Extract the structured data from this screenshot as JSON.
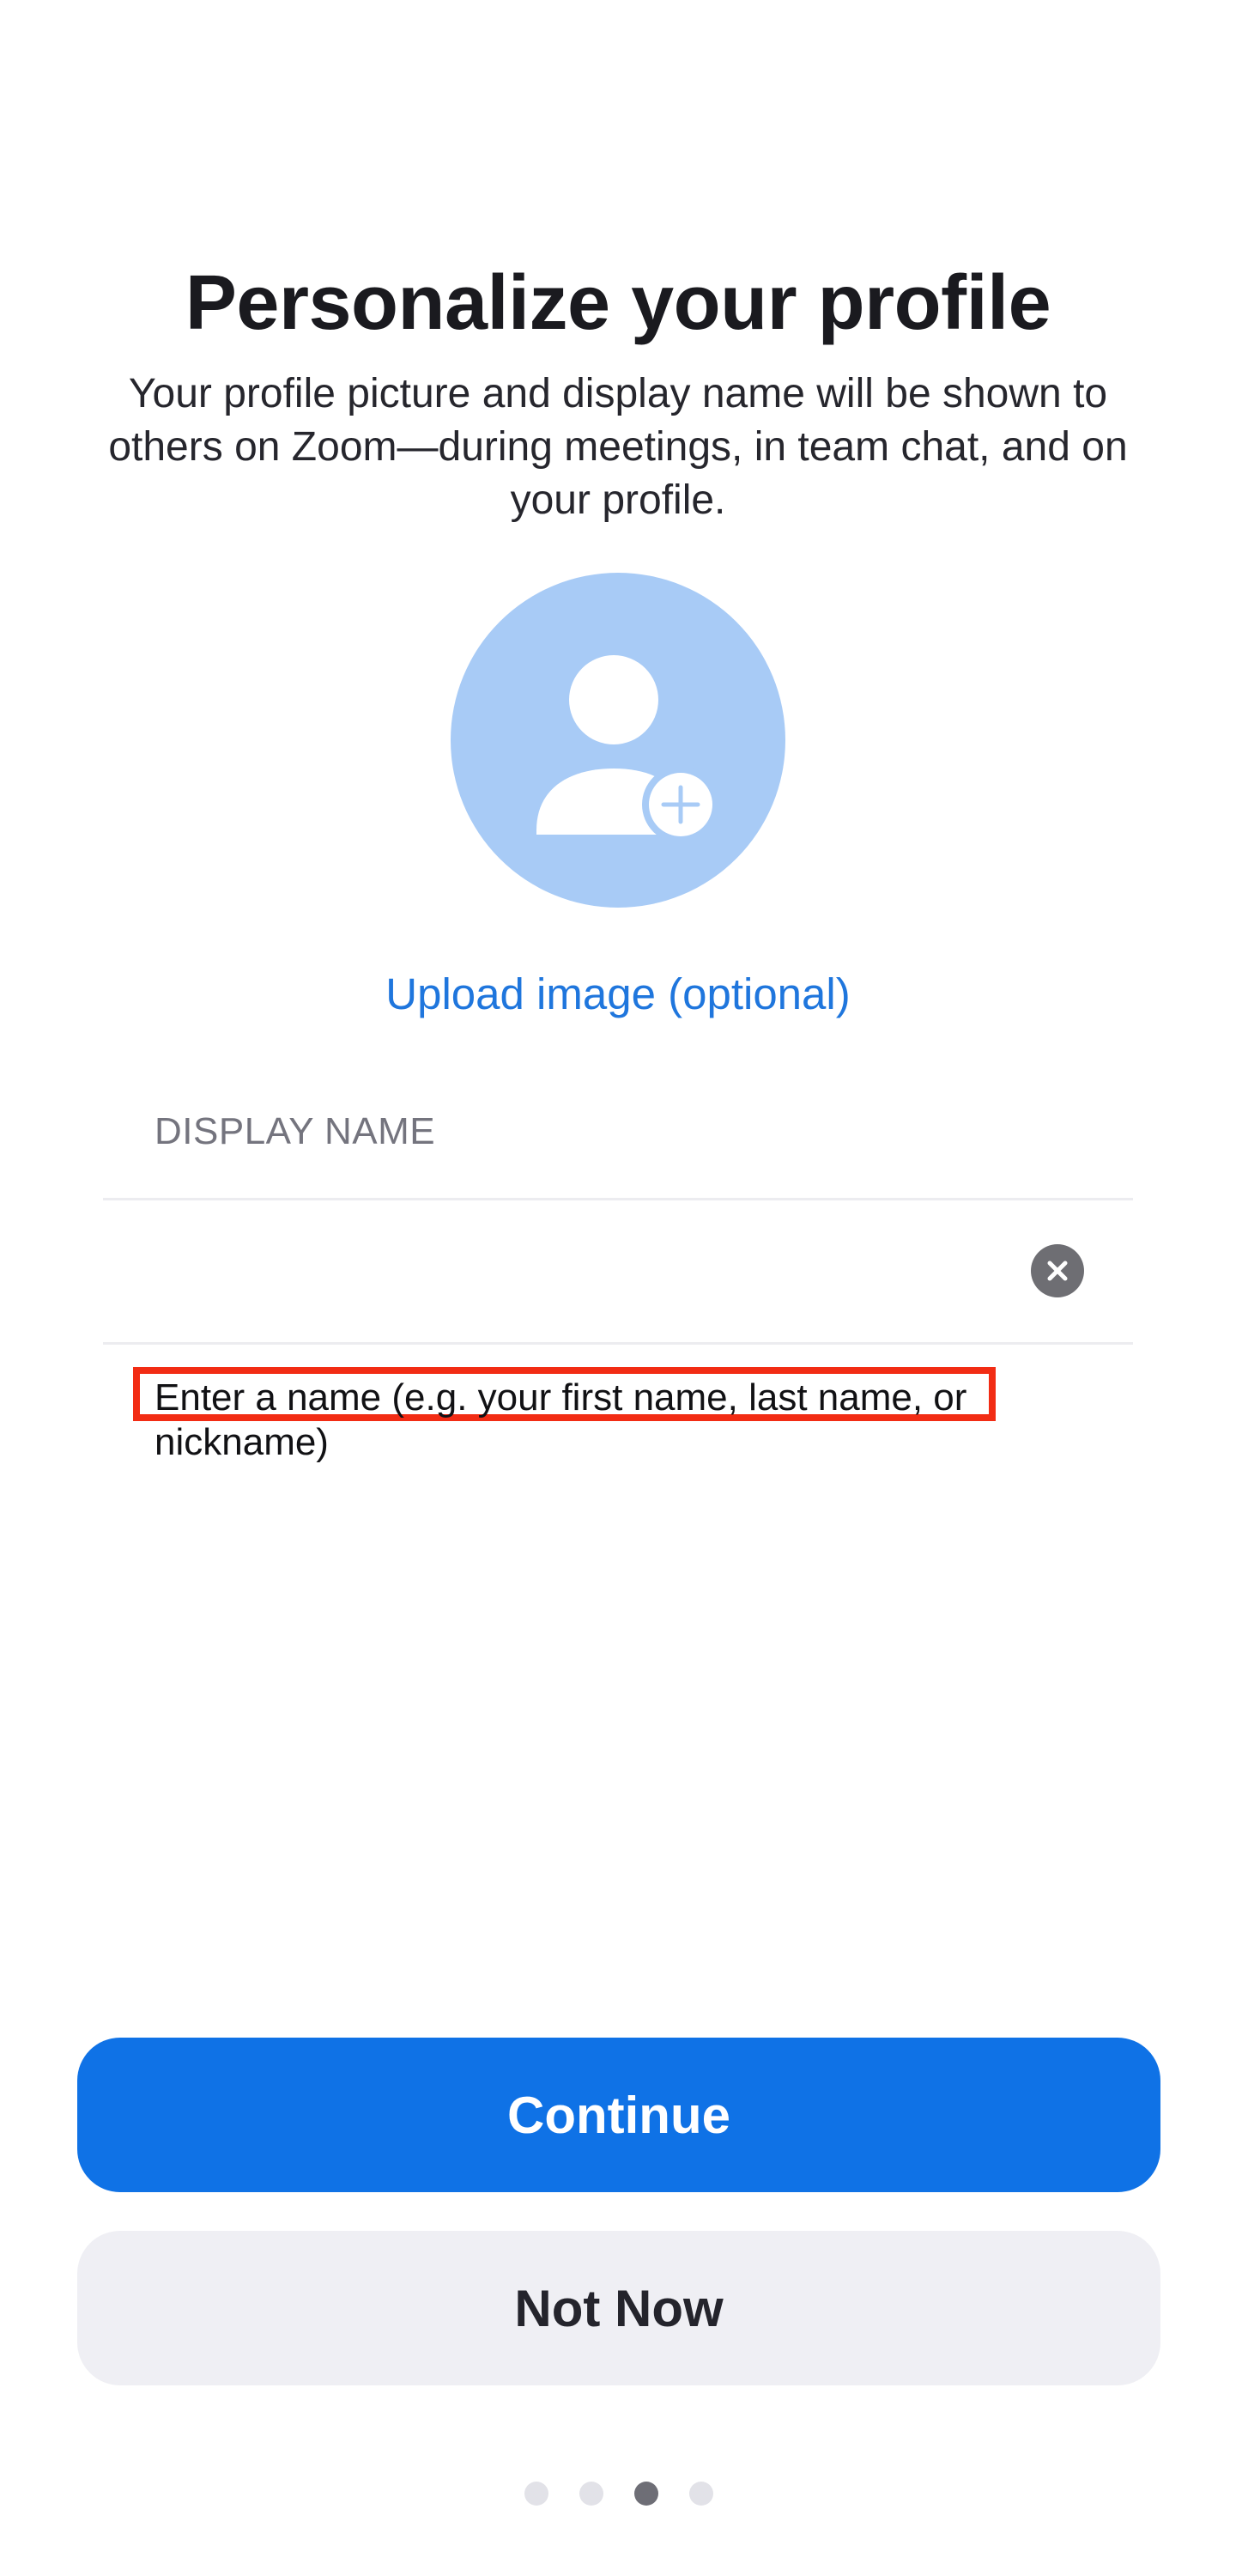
{
  "header": {
    "title": "Personalize your profile",
    "subtitle": "Your profile picture and display name will be shown to others on Zoom—during meetings, in team chat, and on your profile."
  },
  "avatar": {
    "icon": "user-add-icon",
    "background_color": "#a8cbf6"
  },
  "upload": {
    "label": "Upload image (optional)"
  },
  "display_name": {
    "label": "DISPLAY NAME",
    "value": "",
    "clear_icon": "clear-icon",
    "hint": "Enter a name (e.g. your first name, last name, or nickname)"
  },
  "actions": {
    "continue_label": "Continue",
    "not_now_label": "Not Now"
  },
  "pagination": {
    "total": 4,
    "current": 3
  },
  "colors": {
    "primary": "#0f72e6",
    "link": "#1f76dd",
    "highlight_border": "#f22c14"
  }
}
